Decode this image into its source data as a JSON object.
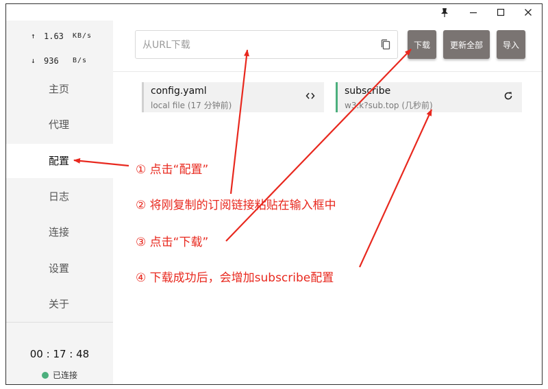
{
  "titlebar": {
    "pin_icon": "pin-icon",
    "minimize_icon": "minimize-icon",
    "maximize_icon": "maximize-icon",
    "close_icon": "close-icon"
  },
  "traffic": {
    "up": {
      "arrow": "↑",
      "value": "1.63",
      "unit": "KB/s"
    },
    "down": {
      "arrow": "↓",
      "value": "936",
      "unit": "B/s"
    }
  },
  "nav": [
    {
      "label": "主页"
    },
    {
      "label": "代理"
    },
    {
      "label": "配置"
    },
    {
      "label": "日志"
    },
    {
      "label": "连接"
    },
    {
      "label": "设置"
    },
    {
      "label": "关于"
    }
  ],
  "status": {
    "timer": "00 : 17 : 48",
    "connection": "已连接",
    "dot_color": "#4caf7d"
  },
  "toolbar": {
    "url_placeholder": "从URL下载",
    "download_label": "下载",
    "update_all_label": "更新全部",
    "import_label": "导入"
  },
  "profiles": [
    {
      "name": "config.yaml",
      "desc": "local file (17 分钟前)",
      "icon": "code-icon"
    },
    {
      "name": "subscribe",
      "desc": "w3.k?sub.top (几秒前)",
      "icon": "refresh-icon",
      "accent": "#4caf7d"
    }
  ],
  "annotations": {
    "color": "#e8281e",
    "notes": [
      "① 点击“配置”",
      "② 将刚复制的订阅链接粘贴在输入框中",
      "③ 点击“下载”",
      "④ 下载成功后，会增加subscribe配置"
    ]
  }
}
